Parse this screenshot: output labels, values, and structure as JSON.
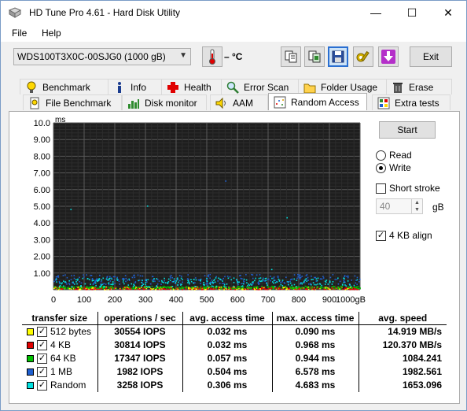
{
  "window": {
    "title": "HD Tune Pro 4.61 - Hard Disk Utility",
    "minimize": "—",
    "maximize": "☐",
    "close": "✕"
  },
  "menu": {
    "file": "File",
    "help": "Help"
  },
  "toolbar": {
    "drive": "WDS100T3X0C-00SJG0 (1000 gB)",
    "temperature": "– °C",
    "exit_label": "Exit"
  },
  "tabs_row1": [
    "Benchmark",
    "Info",
    "Health",
    "Error Scan",
    "Folder Usage",
    "Erase"
  ],
  "tabs_row2": [
    "File Benchmark",
    "Disk monitor",
    "AAM",
    "Random Access",
    "Extra tests"
  ],
  "controls": {
    "start_label": "Start",
    "read_label": "Read",
    "write_label": "Write",
    "short_stroke_label": "Short stroke",
    "short_stroke_value": "40",
    "short_stroke_unit": "gB",
    "align_label": "4 KB align",
    "mode": "write",
    "short_stroke_checked": false,
    "align_checked": true
  },
  "table": {
    "headers": [
      "transfer size",
      "operations / sec",
      "avg. access time",
      "max. access time",
      "avg. speed"
    ],
    "rows": [
      {
        "label": "512 bytes",
        "color": "#ffff00",
        "ops": "30554 IOPS",
        "avg": "0.032 ms",
        "max": "0.090 ms",
        "speed": "14.919 MB/s"
      },
      {
        "label": "4 KB",
        "color": "#e00000",
        "ops": "30814 IOPS",
        "avg": "0.032 ms",
        "max": "0.968 ms",
        "speed": "120.370 MB/s"
      },
      {
        "label": "64 KB",
        "color": "#00c000",
        "ops": "17347 IOPS",
        "avg": "0.057 ms",
        "max": "0.944 ms",
        "speed": "1084.241"
      },
      {
        "label": "1 MB",
        "color": "#1e5fd0",
        "ops": "1982 IOPS",
        "avg": "0.504 ms",
        "max": "6.578 ms",
        "speed": "1982.561"
      },
      {
        "label": "Random",
        "color": "#00e0e0",
        "ops": "3258 IOPS",
        "avg": "0.306 ms",
        "max": "4.683 ms",
        "speed": "1653.096"
      }
    ]
  },
  "chart_data": {
    "type": "scatter",
    "ylabel": "ms",
    "yticks": [
      "10.0",
      "9.00",
      "8.00",
      "7.00",
      "6.00",
      "5.00",
      "4.00",
      "3.00",
      "2.00",
      "1.00"
    ],
    "xticks": [
      "0",
      "100",
      "200",
      "300",
      "400",
      "500",
      "600",
      "700",
      "800",
      "900",
      "1000gB"
    ],
    "xlim": [
      0,
      1000
    ],
    "ylim": [
      0,
      10
    ],
    "grid": true,
    "series": [
      {
        "color": "#ffff00",
        "band": [
          0.0,
          0.15
        ]
      },
      {
        "color": "#e00000",
        "band": [
          0.0,
          0.12
        ]
      },
      {
        "color": "#00c000",
        "band": [
          0.05,
          0.2
        ]
      },
      {
        "color": "#1e5fd0",
        "band": [
          0.3,
          0.9
        ]
      },
      {
        "color": "#00e0e0",
        "band": [
          0.15,
          0.7
        ]
      }
    ],
    "outliers": [
      {
        "x": 55,
        "y": 4.8,
        "color": "#00e0e0"
      },
      {
        "x": 305,
        "y": 5.0,
        "color": "#00e0e0"
      },
      {
        "x": 710,
        "y": 1.2,
        "color": "#00e0e0"
      },
      {
        "x": 760,
        "y": 4.3,
        "color": "#00e0e0"
      },
      {
        "x": 795,
        "y": 0.9,
        "color": "#1e5fd0"
      },
      {
        "x": 560,
        "y": 6.5,
        "color": "#1e5fd0"
      }
    ]
  }
}
